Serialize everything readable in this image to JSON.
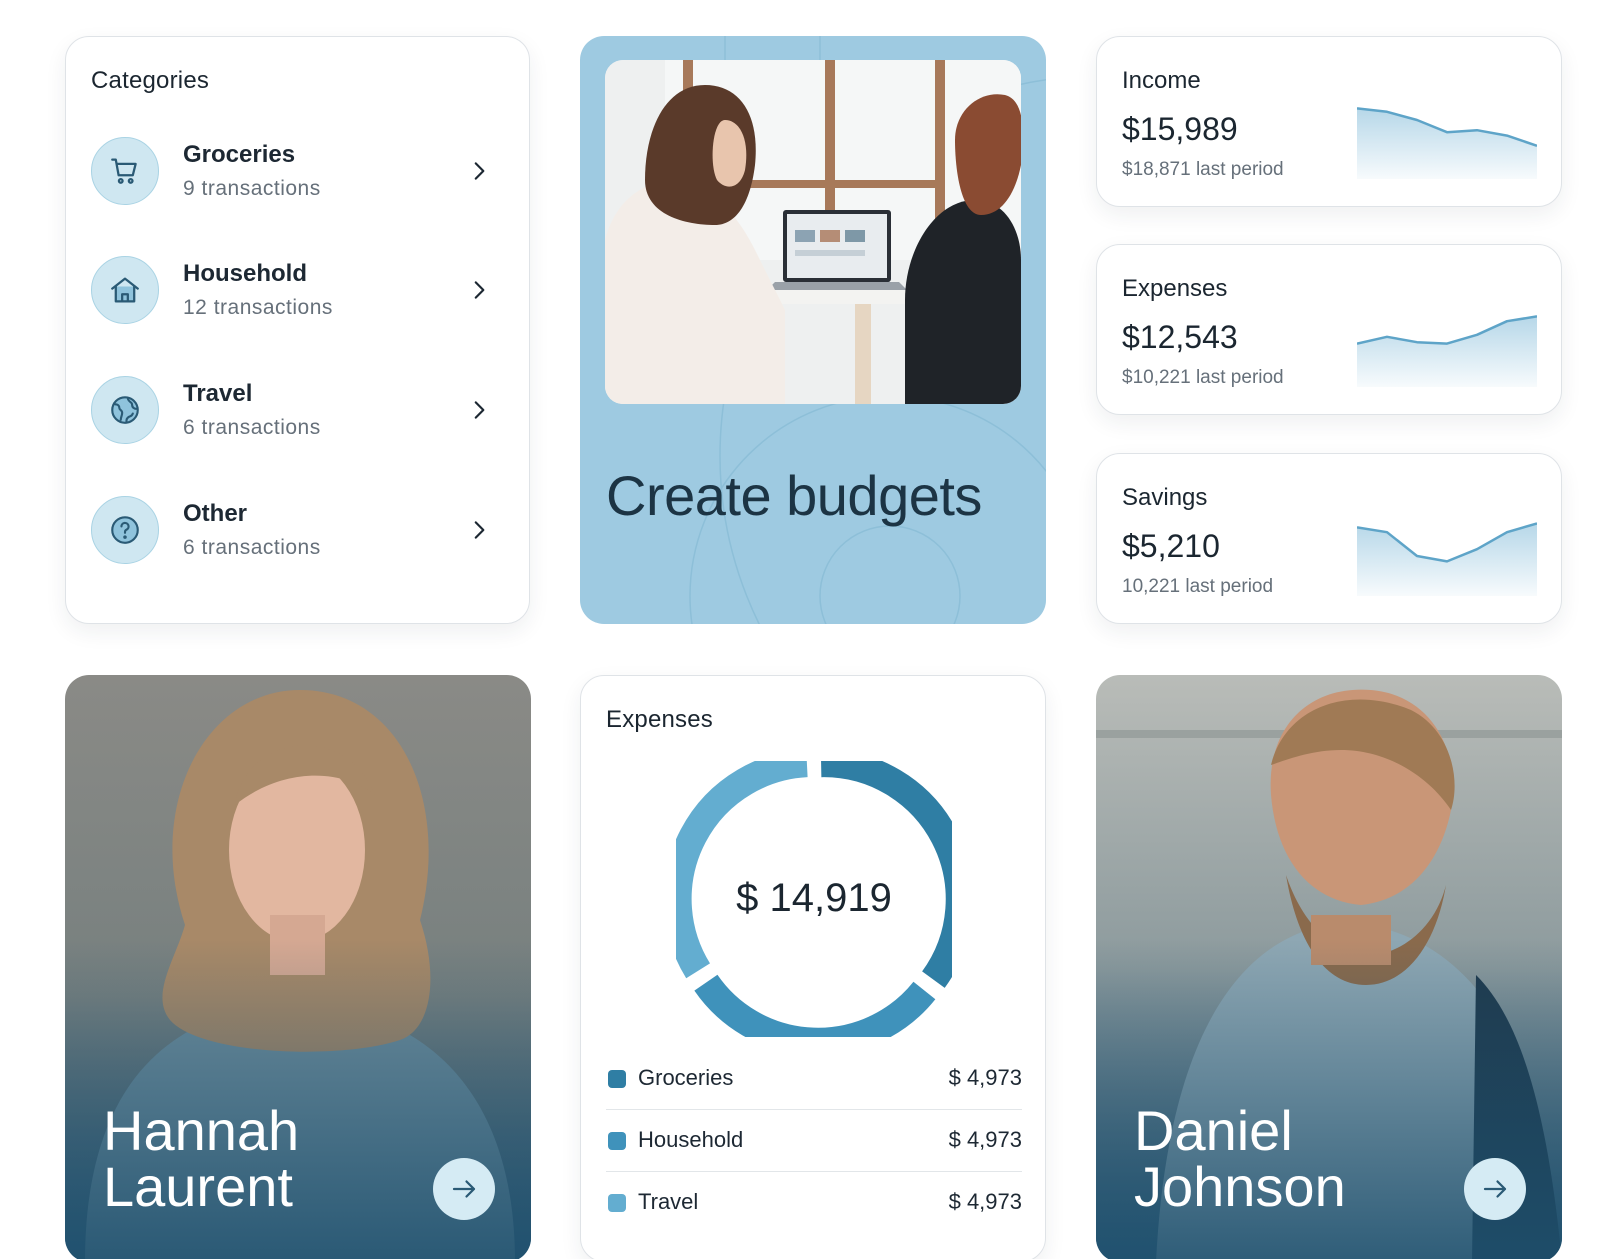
{
  "categories": {
    "title": "Categories",
    "items": [
      {
        "name": "Groceries",
        "count": "9 transactions",
        "icon": "cart-icon"
      },
      {
        "name": "Household",
        "count": "12 transactions",
        "icon": "home-icon"
      },
      {
        "name": "Travel",
        "count": "6 transactions",
        "icon": "globe-icon"
      },
      {
        "name": "Other",
        "count": "6 transactions",
        "icon": "question-icon"
      }
    ]
  },
  "promo": {
    "headline": "Create budgets"
  },
  "stats": [
    {
      "label": "Income",
      "value": "$15,989",
      "sub": "$18,871 last period",
      "trend": [
        0.95,
        0.9,
        0.78,
        0.6,
        0.63,
        0.55,
        0.4
      ]
    },
    {
      "label": "Expenses",
      "value": "$12,543",
      "sub": "$10,221 last period",
      "trend": [
        0.55,
        0.65,
        0.57,
        0.55,
        0.68,
        0.88,
        0.95
      ]
    },
    {
      "label": "Savings",
      "value": "$5,210",
      "sub": "10,221 last period",
      "trend": [
        0.92,
        0.85,
        0.5,
        0.42,
        0.6,
        0.85,
        0.98
      ]
    }
  ],
  "people": [
    {
      "first": "Hannah",
      "last": "Laurent"
    },
    {
      "first": "Daniel",
      "last": "Johnson"
    }
  ],
  "expenses": {
    "title": "Expenses",
    "total": "$ 14,919",
    "items": [
      {
        "name": "Groceries",
        "amount": "$ 4,973",
        "color": "#2f7ea4"
      },
      {
        "name": "Household",
        "amount": "$ 4,973",
        "color": "#3f92bb"
      },
      {
        "name": "Travel",
        "amount": "$ 4,973",
        "color": "#63add0"
      }
    ]
  },
  "colors": {
    "accent": "#9ecae1",
    "dark_blue": "#2f7ea4",
    "text": "#1b2630",
    "muted": "#66707a"
  }
}
